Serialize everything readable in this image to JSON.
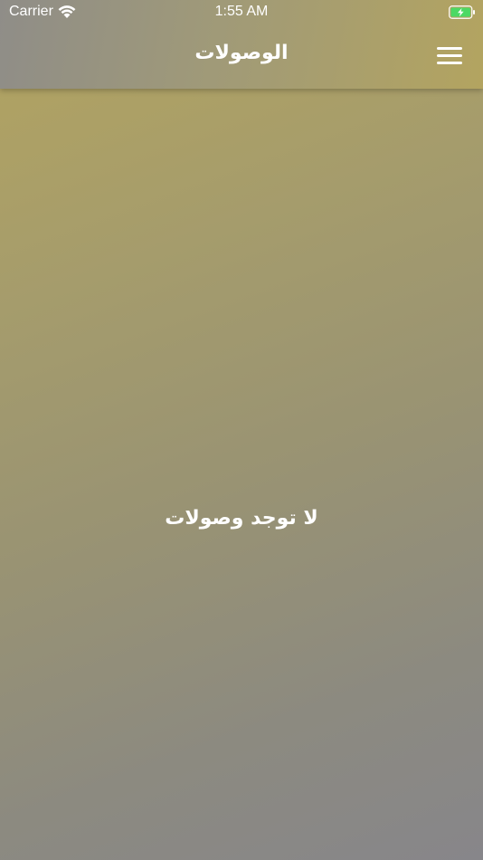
{
  "status_bar": {
    "carrier": "Carrier",
    "time": "1:55 AM",
    "wifi_icon": "wifi-icon",
    "battery_icon": "battery-charging-icon",
    "battery_color": "#4cd964"
  },
  "nav_bar": {
    "title": "الوصولات",
    "menu_icon": "hamburger-menu-icon"
  },
  "main": {
    "empty_message": "لا توجد وصولات"
  },
  "colors": {
    "gradient_gold": "#b3a460",
    "gradient_gray": "#87868a",
    "text": "#ffffff"
  }
}
